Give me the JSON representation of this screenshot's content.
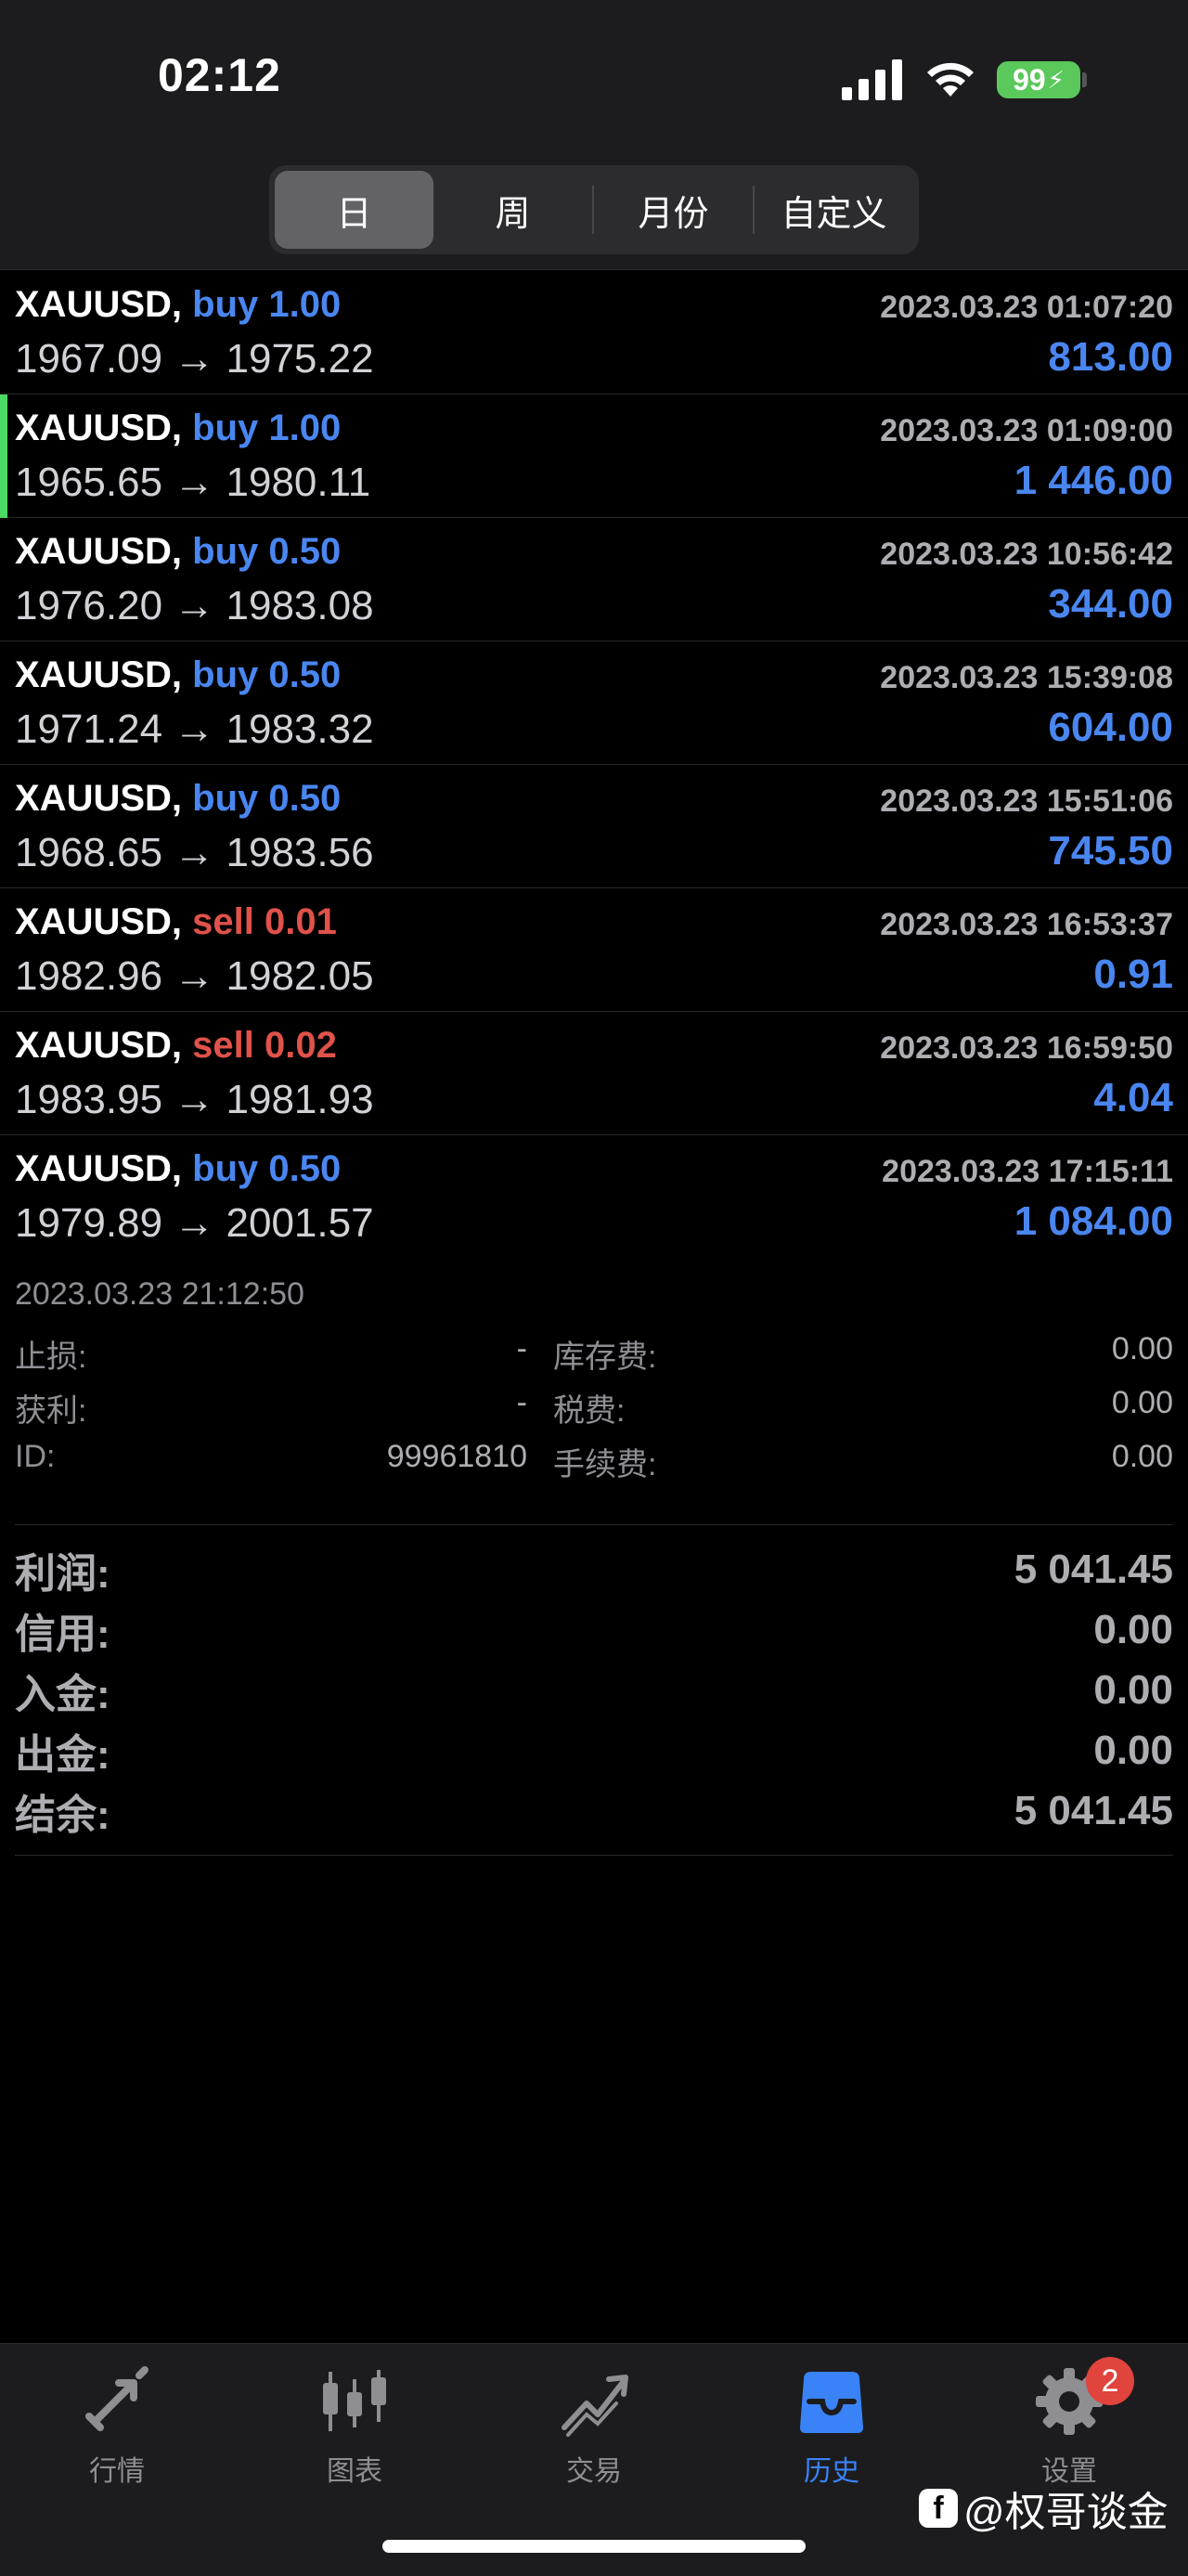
{
  "status_bar": {
    "time": "02:12",
    "battery": "99"
  },
  "period_tabs": [
    {
      "label": "日",
      "active": true
    },
    {
      "label": "周",
      "active": false
    },
    {
      "label": "月份",
      "active": false
    },
    {
      "label": "自定义",
      "active": false
    }
  ],
  "trades": [
    {
      "symbol": "XAUUSD,",
      "action": "buy",
      "volume": "1.00",
      "datetime": "2023.03.23 01:07:20",
      "prices": "1967.09 → 1975.22",
      "profit": "813.00"
    },
    {
      "symbol": "XAUUSD,",
      "action": "buy",
      "volume": "1.00",
      "datetime": "2023.03.23 01:09:00",
      "prices": "1965.65 → 1980.11",
      "profit": "1 446.00"
    },
    {
      "symbol": "XAUUSD,",
      "action": "buy",
      "volume": "0.50",
      "datetime": "2023.03.23 10:56:42",
      "prices": "1976.20 → 1983.08",
      "profit": "344.00"
    },
    {
      "symbol": "XAUUSD,",
      "action": "buy",
      "volume": "0.50",
      "datetime": "2023.03.23 15:39:08",
      "prices": "1971.24 → 1983.32",
      "profit": "604.00"
    },
    {
      "symbol": "XAUUSD,",
      "action": "buy",
      "volume": "0.50",
      "datetime": "2023.03.23 15:51:06",
      "prices": "1968.65 → 1983.56",
      "profit": "745.50"
    },
    {
      "symbol": "XAUUSD,",
      "action": "sell",
      "volume": "0.01",
      "datetime": "2023.03.23 16:53:37",
      "prices": "1982.96 → 1982.05",
      "profit": "0.91"
    },
    {
      "symbol": "XAUUSD,",
      "action": "sell",
      "volume": "0.02",
      "datetime": "2023.03.23 16:59:50",
      "prices": "1983.95 → 1981.93",
      "profit": "4.04"
    },
    {
      "symbol": "XAUUSD,",
      "action": "buy",
      "volume": "0.50",
      "datetime": "2023.03.23 17:15:11",
      "prices": "1979.89 → 2001.57",
      "profit": "1 084.00"
    }
  ],
  "details": {
    "close_time": "2023.03.23 21:12:50",
    "stop_loss_label": "止损:",
    "stop_loss": "-",
    "take_profit_label": "获利:",
    "take_profit": "-",
    "id_label": "ID:",
    "id": "99961810",
    "swap_label": "库存费:",
    "swap": "0.00",
    "tax_label": "税费:",
    "tax": "0.00",
    "commission_label": "手续费:",
    "commission": "0.00"
  },
  "summary": [
    {
      "label": "利润:",
      "value": "5 041.45"
    },
    {
      "label": "信用:",
      "value": "0.00"
    },
    {
      "label": "入金:",
      "value": "0.00"
    },
    {
      "label": "出金:",
      "value": "0.00"
    },
    {
      "label": "结余:",
      "value": "5 041.45"
    }
  ],
  "tabbar": [
    {
      "label": "行情",
      "icon": "quotes-arrows-icon",
      "active": false
    },
    {
      "label": "图表",
      "icon": "candlestick-chart-icon",
      "active": false
    },
    {
      "label": "交易",
      "icon": "trade-trend-icon",
      "active": false
    },
    {
      "label": "历史",
      "icon": "inbox-tray-icon",
      "active": true
    },
    {
      "label": "设置",
      "icon": "gear-icon",
      "active": false,
      "badge": "2"
    }
  ],
  "watermark": "@权哥谈金",
  "colors": {
    "buy": "#4a86f0",
    "sell": "#e0524a",
    "active_tab": "#3a82f7",
    "selected_marker": "#4cd964"
  }
}
